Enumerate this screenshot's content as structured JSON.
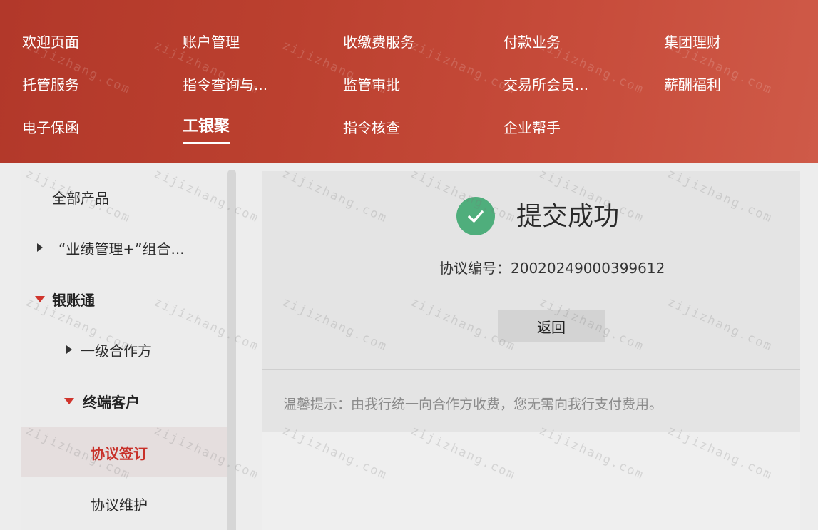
{
  "topnav": {
    "items": [
      {
        "label": "欢迎页面"
      },
      {
        "label": "账户管理"
      },
      {
        "label": "收缴费服务"
      },
      {
        "label": "付款业务"
      },
      {
        "label": "集团理财"
      },
      {
        "label": "托管服务"
      },
      {
        "label": "指令查询与..."
      },
      {
        "label": "监管审批"
      },
      {
        "label": "交易所会员..."
      },
      {
        "label": "薪酬福利"
      },
      {
        "label": "电子保函"
      },
      {
        "label": "工银聚",
        "active": true
      },
      {
        "label": "指令核查"
      },
      {
        "label": "企业帮手"
      }
    ]
  },
  "sidebar": {
    "items": [
      {
        "label": "全部产品"
      },
      {
        "label": "“业绩管理+”组合..."
      },
      {
        "label": "银账通"
      },
      {
        "label": "一级合作方"
      },
      {
        "label": "终端客户"
      },
      {
        "label": "协议签订"
      },
      {
        "label": "协议维护"
      }
    ]
  },
  "result": {
    "title": "提交成功",
    "agreement_label": "协议编号：",
    "agreement_number": "20020249000399612",
    "back_label": "返回",
    "tip": "温馨提示：由我行统一向合作方收费，您无需向我行支付费用。"
  },
  "watermark": {
    "text": "zijizhang.com"
  },
  "colors": {
    "nav_bg": "#b93e2e",
    "success_green": "#4fae7c",
    "active_red": "#c8312a"
  }
}
